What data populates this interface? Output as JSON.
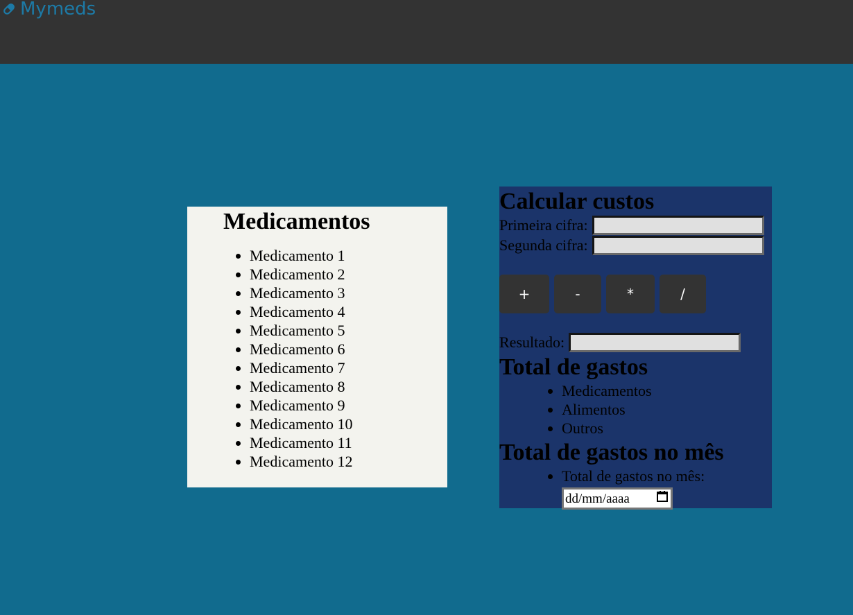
{
  "header": {
    "brand": "Mymeds",
    "brand_icon": "pill-icon"
  },
  "colors": {
    "page_bg": "#116b8e",
    "topbar_bg": "#333333",
    "brand_text": "#1d7aa6",
    "meds_panel_bg": "#f3f3ee",
    "calc_panel_bg": "#1b346a",
    "button_bg": "#333333"
  },
  "medications": {
    "title": "Medicamentos",
    "items": [
      "Medicamento 1",
      "Medicamento 2",
      "Medicamento 3",
      "Medicamento 4",
      "Medicamento 5",
      "Medicamento 6",
      "Medicamento 7",
      "Medicamento 8",
      "Medicamento 9",
      "Medicamento 10",
      "Medicamento 11",
      "Medicamento 12"
    ]
  },
  "calculator": {
    "title": "Calcular custos",
    "first_label": "Primeira cifra:",
    "first_value": "",
    "second_label": "Segunda cifra:",
    "second_value": "",
    "operations": [
      "+",
      "-",
      "*",
      "/"
    ],
    "result_label": "Resultado:",
    "result_value": ""
  },
  "expenses": {
    "title": "Total de gastos",
    "items": [
      "Medicamentos",
      "Alimentos",
      "Outros"
    ]
  },
  "monthly": {
    "title": "Total de gastos no mês",
    "item_label": "Total de gastos no mês:",
    "date_placeholder": "dd/mm/aaaa",
    "calendar_icon": "calendar-icon"
  }
}
